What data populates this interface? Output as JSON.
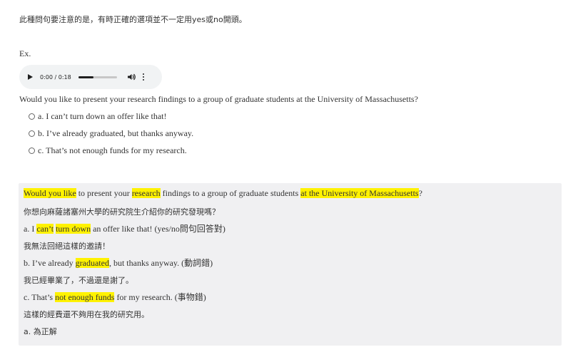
{
  "intro": "此種問句要注意的是，有時正確的選項並不一定用yes或no開頭。",
  "example_label": "Ex.",
  "audio": {
    "time": "0:00 / 0:18",
    "progress": 0.4
  },
  "question": "Would you like to present your research findings to a group of graduate students at the University of Massachusetts?",
  "options": [
    "a. I can’t turn down an offer like that!",
    "b. I’ve already graduated, but thanks anyway.",
    "c. That’s not enough funds for my research."
  ],
  "answer": {
    "q": [
      "Would you like",
      " to present your ",
      "research",
      " findings to a group of graduate students ",
      "at the University of Massachusetts",
      "?"
    ],
    "q_zh": "你想向麻薩諸塞州大學的研究院生介紹你的研究發現嗎？",
    "a": [
      "a. I ",
      "can’t",
      " ",
      "turn down",
      " an offer like that! (yes/no問句回答對)"
    ],
    "a_zh": "我無法回絕這樣的邀請！",
    "b": [
      "b. I’ve already ",
      "graduated",
      ", but thanks anyway. (動詞錯)"
    ],
    "b_zh": "我已經畢業了，不過還是謝了。",
    "c": [
      "c. That’s ",
      "not enough funds",
      " for my research. (事物錯)"
    ],
    "c_zh": "這樣的經費還不夠用在我的研究用。",
    "correct": "a. 為正解"
  }
}
